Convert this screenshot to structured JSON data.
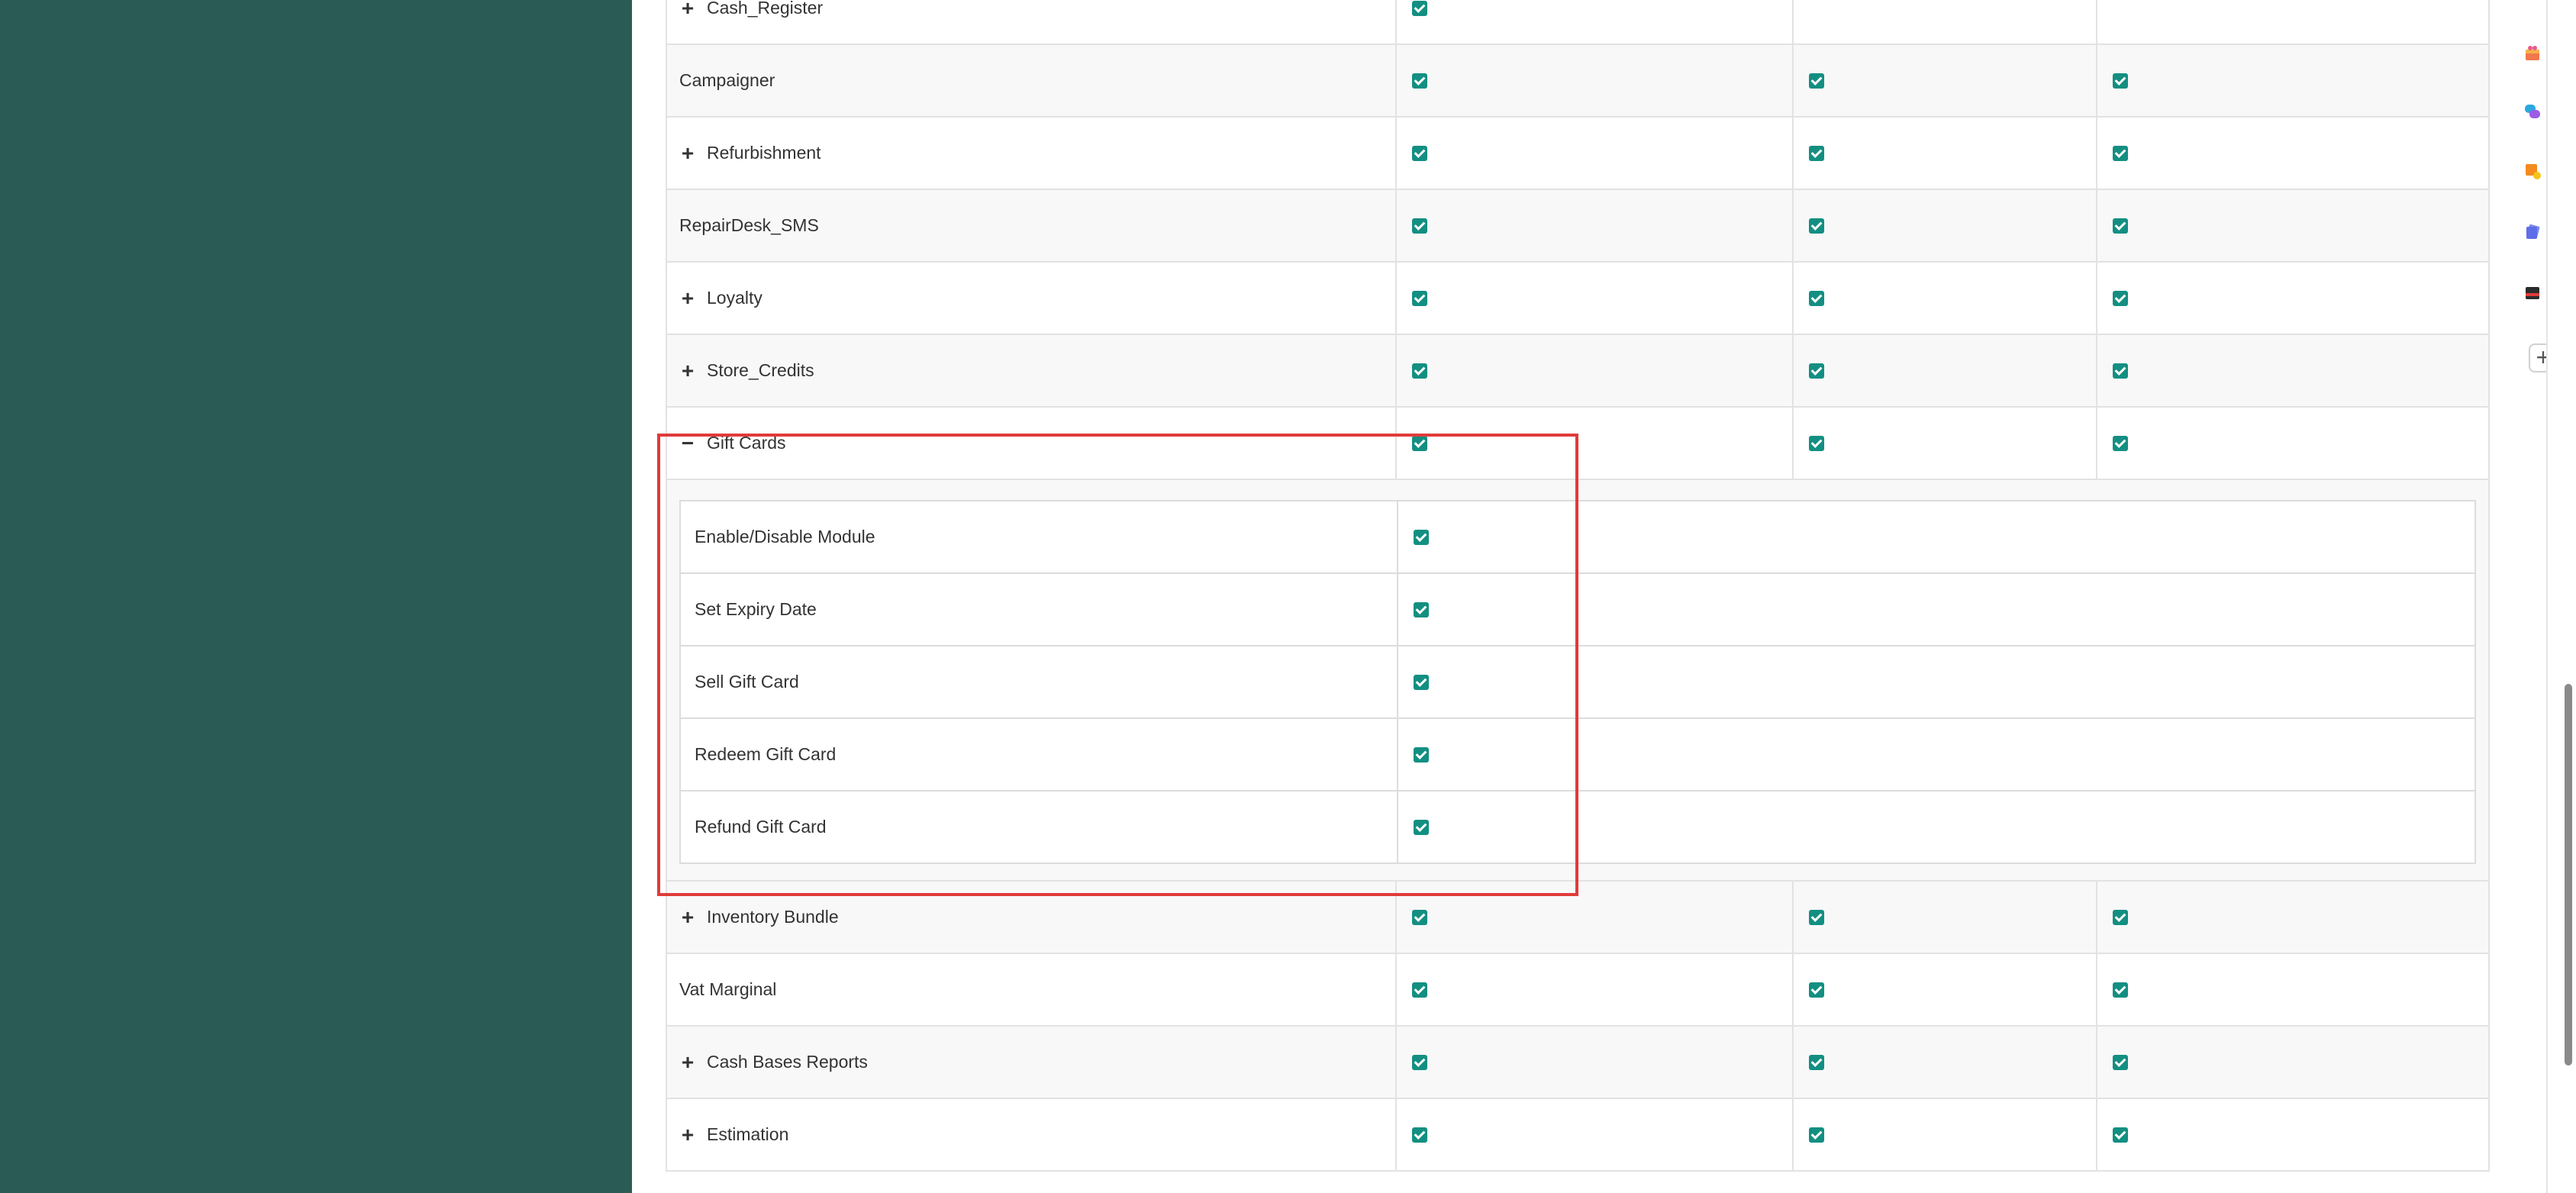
{
  "colors": {
    "sidebar": "#2b5b55",
    "checkbox": "#138f82",
    "highlight": "#e03a3a"
  },
  "rows_before": [
    {
      "label": "Cash_Register",
      "toggle": "+",
      "checks": [
        true,
        false,
        false
      ]
    },
    {
      "label": "Campaigner",
      "toggle": "",
      "checks": [
        true,
        true,
        true
      ]
    },
    {
      "label": "Refurbishment",
      "toggle": "+",
      "checks": [
        true,
        true,
        true
      ]
    },
    {
      "label": "RepairDesk_SMS",
      "toggle": "",
      "checks": [
        true,
        true,
        true
      ]
    },
    {
      "label": "Loyalty",
      "toggle": "+",
      "checks": [
        true,
        true,
        true
      ]
    },
    {
      "label": "Store_Credits",
      "toggle": "+",
      "checks": [
        true,
        true,
        true
      ]
    },
    {
      "label": "Gift Cards",
      "toggle": "−",
      "checks": [
        true,
        true,
        true
      ]
    }
  ],
  "gift_cards_sub": [
    {
      "label": "Enable/Disable Module",
      "checked": true
    },
    {
      "label": "Set Expiry Date",
      "checked": true
    },
    {
      "label": "Sell Gift Card",
      "checked": true
    },
    {
      "label": "Redeem Gift Card",
      "checked": true
    },
    {
      "label": "Refund Gift Card",
      "checked": true
    }
  ],
  "rows_after": [
    {
      "label": "Inventory Bundle",
      "toggle": "+",
      "checks": [
        true,
        true,
        true
      ]
    },
    {
      "label": "Vat Marginal",
      "toggle": "",
      "checks": [
        true,
        true,
        true
      ]
    },
    {
      "label": "Cash Bases Reports",
      "toggle": "+",
      "checks": [
        true,
        true,
        true
      ]
    },
    {
      "label": "Estimation",
      "toggle": "+",
      "checks": [
        true,
        true,
        true
      ]
    }
  ],
  "right_icons": [
    "gift-app-icon",
    "chat-app-icon",
    "notes-app-icon",
    "cards-app-icon",
    "wallet-app-icon"
  ],
  "add_button_label": "+"
}
